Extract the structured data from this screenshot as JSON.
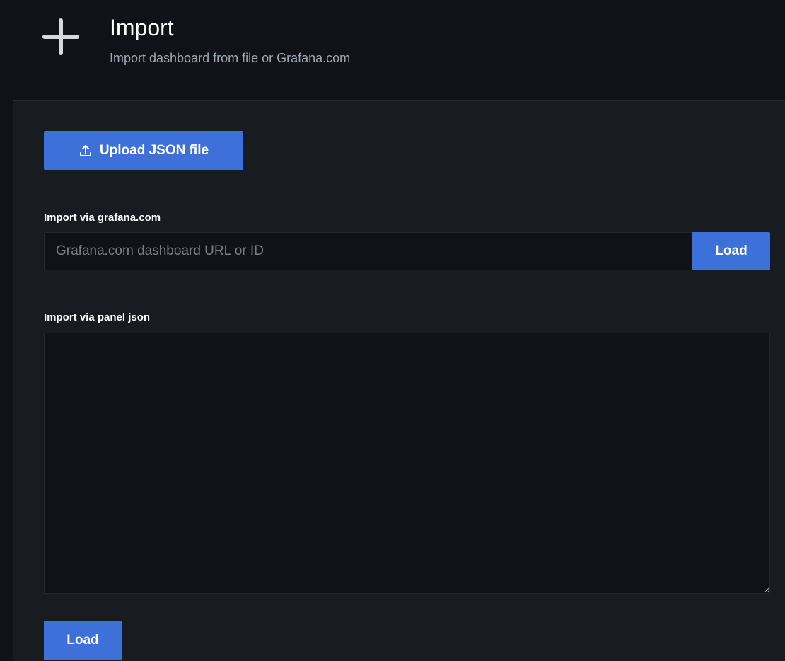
{
  "header": {
    "icon": "plus-icon",
    "title": "Import",
    "subtitle": "Import dashboard from file or Grafana.com"
  },
  "upload": {
    "icon": "upload-icon",
    "label": "Upload JSON file"
  },
  "grafana_import": {
    "label": "Import via grafana.com",
    "input_value": "",
    "placeholder": "Grafana.com dashboard URL or ID",
    "load_label": "Load"
  },
  "panel_json": {
    "label": "Import via panel json",
    "value": "",
    "load_label": "Load"
  },
  "colors": {
    "background": "#111217",
    "panel": "#181b1f",
    "primary": "#3d71d9",
    "text": "#ffffff",
    "secondary_text": "#9fa7b3"
  }
}
